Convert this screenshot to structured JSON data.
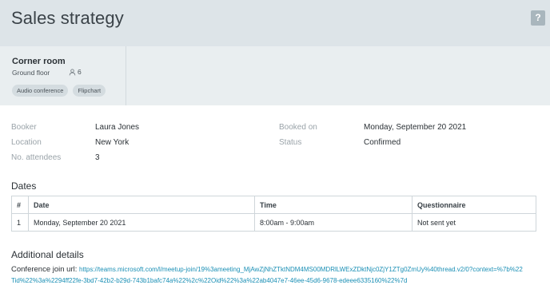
{
  "header": {
    "title": "Sales strategy",
    "help_label": "?"
  },
  "room": {
    "name": "Corner room",
    "floor": "Ground floor",
    "capacity": "6",
    "tags": [
      "Audio conference",
      "Flipchart"
    ]
  },
  "details": {
    "booker_label": "Booker",
    "booker_value": "Laura Jones",
    "location_label": "Location",
    "location_value": "New York",
    "attendees_label": "No. attendees",
    "attendees_value": "3",
    "booked_on_label": "Booked on",
    "booked_on_value": "Monday, September 20 2021",
    "status_label": "Status",
    "status_value": "Confirmed"
  },
  "dates": {
    "title": "Dates",
    "columns": [
      "#",
      "Date",
      "Time",
      "Questionnaire"
    ],
    "rows": [
      [
        "1",
        "Monday, September 20 2021",
        "8:00am - 9:00am",
        "Not sent yet"
      ]
    ]
  },
  "additional": {
    "title": "Additional details",
    "conference_label": "Conference join url:",
    "conference_url": "https://teams.microsoft.com/l/meetup-join/19%3ameeting_MjAwZjNhZTktNDM4MS00MDRlLWExZDktNjc0ZjY1ZTg0ZmUy%40thread.v2/0?context=%7b%22Tid%22%3a%2294ff22fe-3bd7-42b2-b29d-743b1bafc74a%22%2c%22Oid%22%3a%22ab4047e7-46ee-45d6-9678-edeee6335160%22%7d"
  },
  "colors": {
    "header_bg": "#dde4e8",
    "room_bg": "#e9eef0",
    "link": "#1a8fb5"
  },
  "icons": {
    "help": "question-mark-icon",
    "capacity": "person-icon"
  }
}
